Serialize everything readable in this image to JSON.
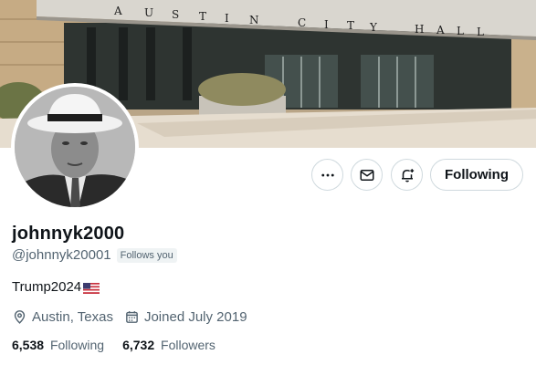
{
  "banner": {
    "sign_letters": [
      "A",
      "U",
      "S",
      "T",
      "I",
      "N",
      "C",
      "I",
      "T",
      "Y",
      "H",
      "A",
      "L",
      "L"
    ]
  },
  "profile": {
    "display_name": "johnnyk2000",
    "handle": "@johnnyk20001",
    "follows_you_badge": "Follows you",
    "bio": "Trump2024",
    "location": "Austin, Texas",
    "joined": "Joined July 2019"
  },
  "actions": {
    "more_icon": "more-horizontal-icon",
    "message_icon": "envelope-icon",
    "notify_icon": "bell-plus-icon",
    "follow_label": "Following"
  },
  "stats": {
    "following_count": "6,538",
    "following_label": "Following",
    "followers_count": "6,732",
    "followers_label": "Followers"
  },
  "colors": {
    "text_primary": "#0f1419",
    "text_secondary": "#536471",
    "border": "#cfd9de",
    "badge_bg": "#eff3f4"
  }
}
